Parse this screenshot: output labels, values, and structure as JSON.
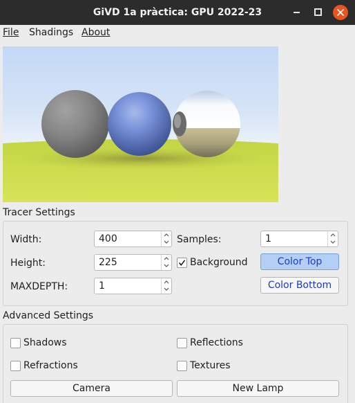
{
  "window": {
    "title": "GiVD 1a pràctica: GPU 2022-23",
    "accent_color": "#e95420"
  },
  "menubar": {
    "file": "File",
    "shadings": "Shadings",
    "about": "About"
  },
  "tracer_settings": {
    "title": "Tracer Settings",
    "width_label": "Width:",
    "width_value": "400",
    "height_label": "Height:",
    "height_value": "225",
    "maxdepth_label": "MAXDEPTH:",
    "maxdepth_value": "1",
    "samples_label": "Samples:",
    "samples_value": "1",
    "background_label": "Background",
    "background_checked": true,
    "color_top_label": "Color Top",
    "color_bottom_label": "Color Bottom"
  },
  "advanced_settings": {
    "title": "Advanced Settings",
    "shadows_label": "Shadows",
    "reflections_label": "Reflections",
    "refractions_label": "Refractions",
    "textures_label": "Textures",
    "camera_label": "Camera",
    "new_lamp_label": "New Lamp"
  }
}
